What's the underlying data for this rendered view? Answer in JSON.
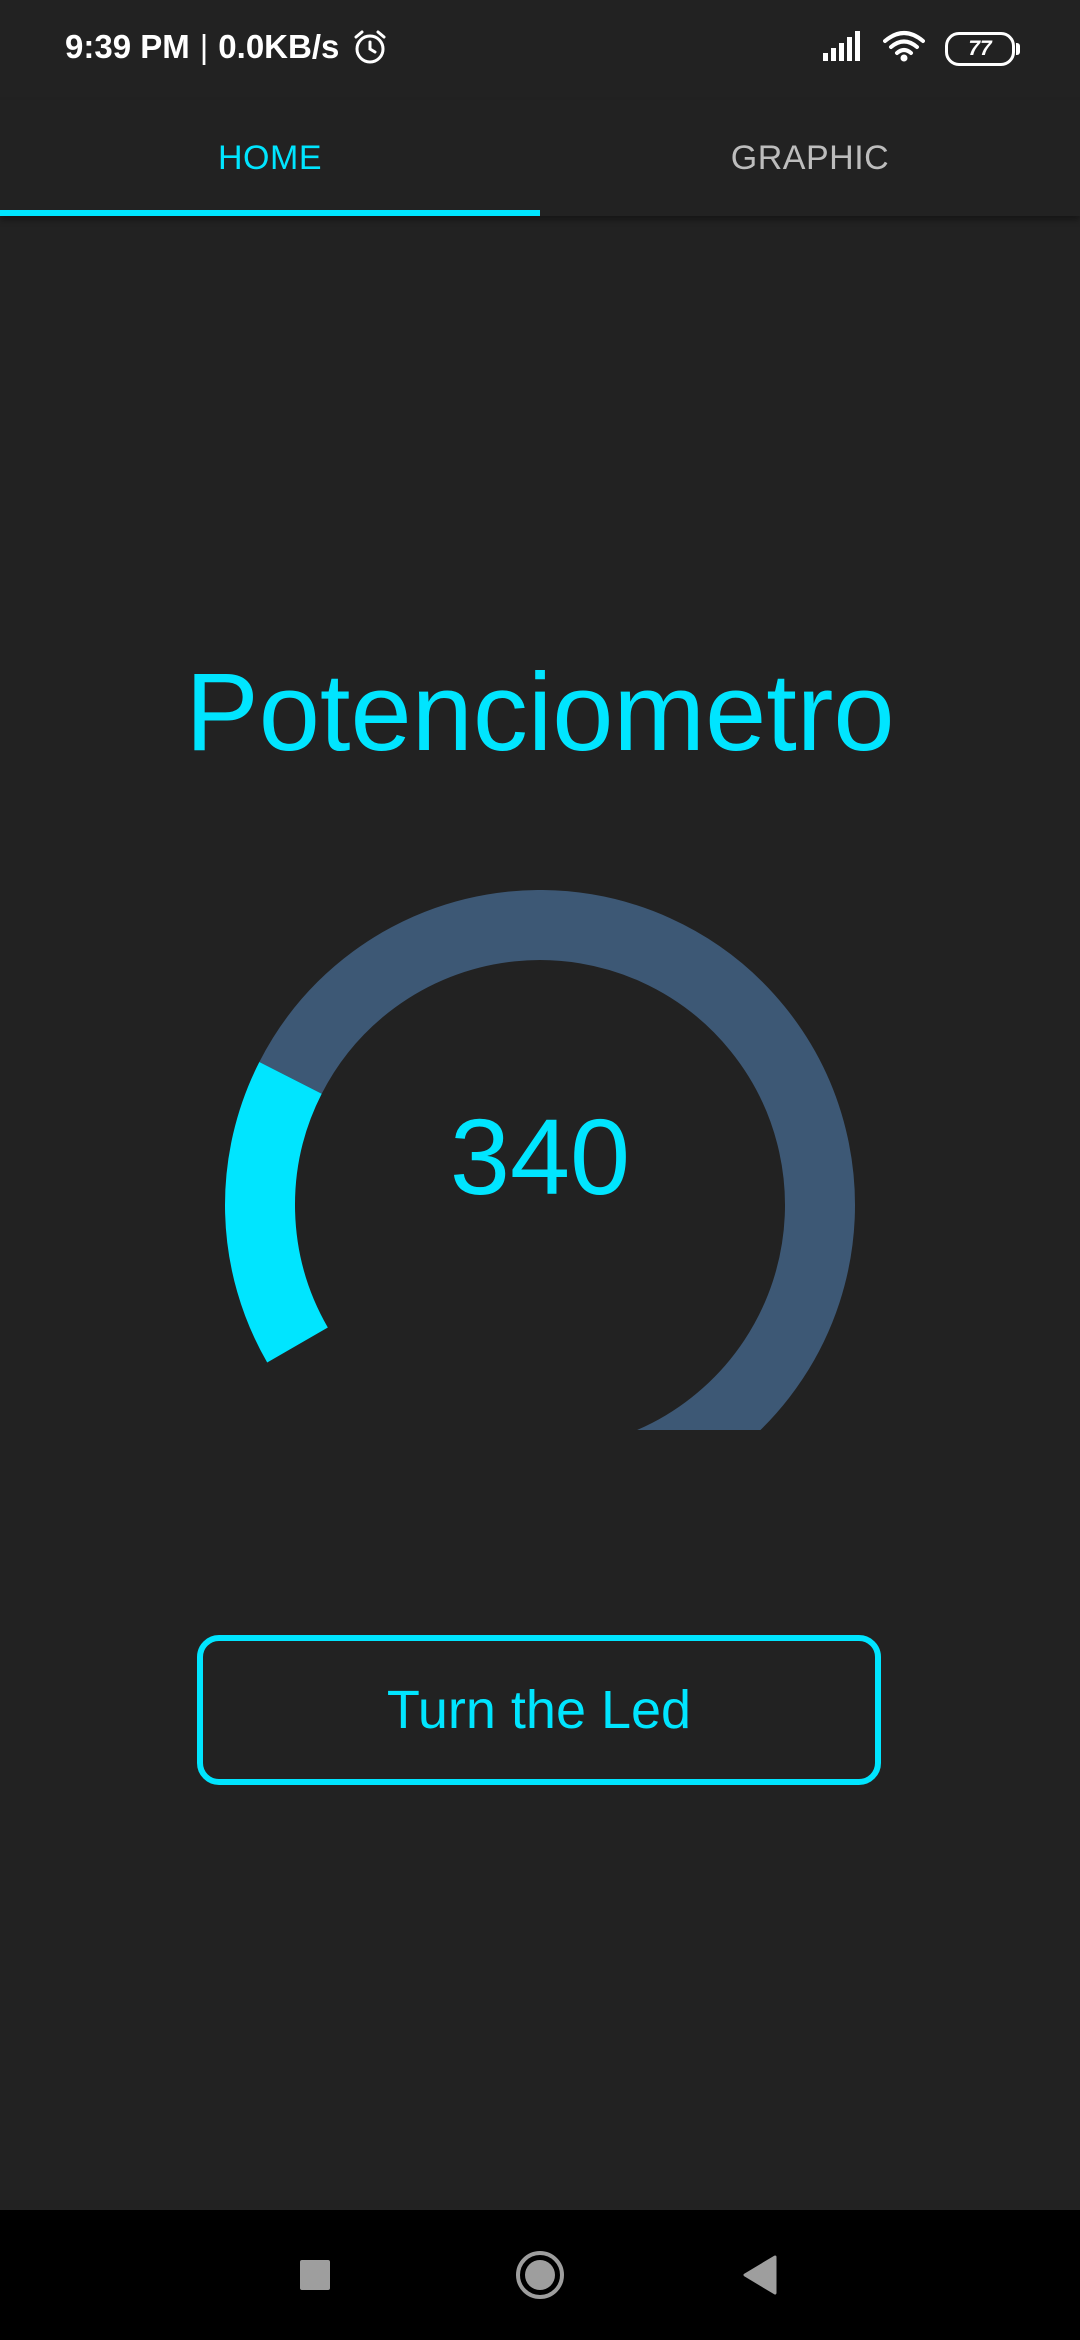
{
  "status_bar": {
    "time": "9:39 PM",
    "separator": "|",
    "network_speed": "0.0KB/s",
    "battery_level": "77",
    "icons": [
      "alarm-icon",
      "signal-icon",
      "wifi-icon",
      "battery-icon"
    ]
  },
  "tabs": [
    {
      "label": "HOME",
      "active": true
    },
    {
      "label": "GRAPHIC",
      "active": false
    }
  ],
  "main": {
    "title": "Potenciometro",
    "gauge": {
      "value": "340",
      "fill_fraction": 0.2,
      "fill_color": "#00e5ff",
      "track_color": "#3d5875"
    },
    "button_label": "Turn the Led"
  },
  "nav_bar": {
    "buttons": [
      "recents-square-icon",
      "home-circle-icon",
      "back-triangle-icon"
    ]
  },
  "colors": {
    "accent": "#00e5ff",
    "background": "#222222",
    "tab_inactive": "#bdbdbd"
  }
}
